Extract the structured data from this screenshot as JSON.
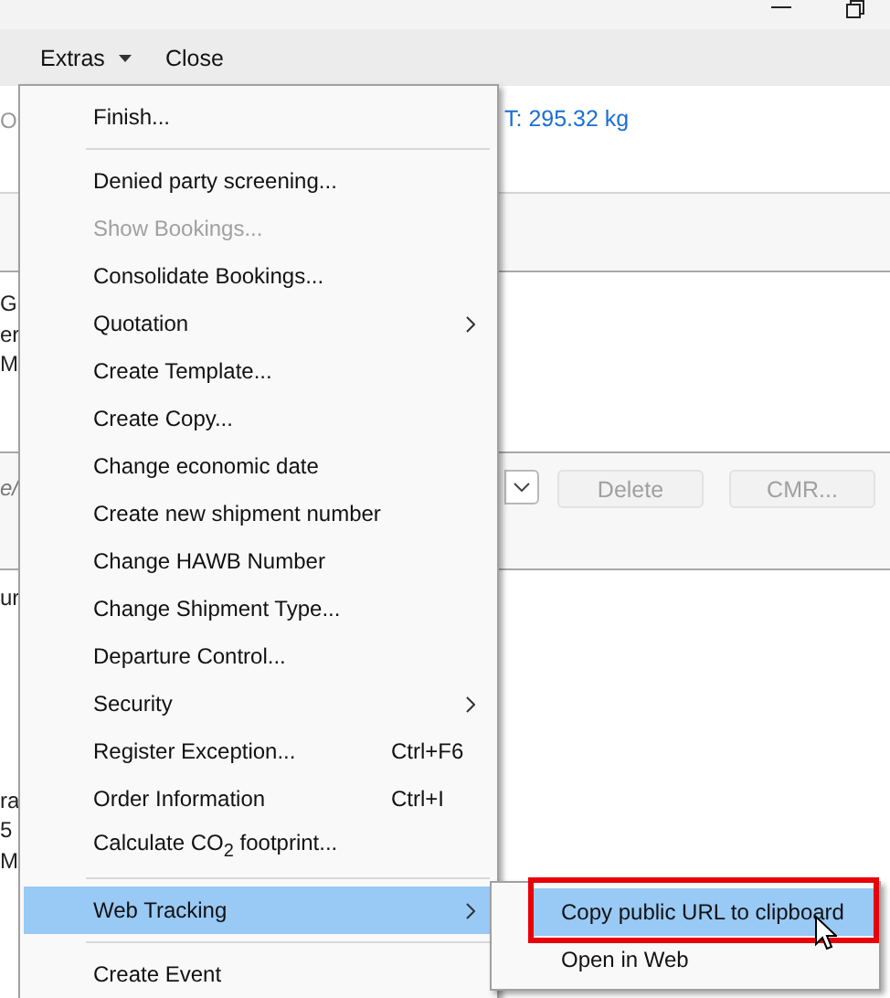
{
  "window": {
    "controls": [
      {
        "kind": "minimize"
      },
      {
        "kind": "restore"
      }
    ]
  },
  "toolbar": [
    {
      "label": "Extras",
      "dropdown": true
    },
    {
      "label": "Close",
      "dropdown": false
    }
  ],
  "header": {
    "weight_text": "T: 295.32 kg"
  },
  "background_fragments": [
    "O",
    "G",
    "er",
    "M",
    "e/",
    "ur",
    "ra",
    "5",
    "M"
  ],
  "actions": [
    {
      "label": "Delete",
      "disabled": true
    },
    {
      "label": "CMR...",
      "disabled": true
    }
  ],
  "menu": [
    {
      "kind": "item",
      "label": "Finish...",
      "disabled": false,
      "submenu": false,
      "selected": false
    },
    {
      "kind": "separator"
    },
    {
      "kind": "item",
      "label": "Denied party screening...",
      "disabled": false,
      "submenu": false,
      "selected": false
    },
    {
      "kind": "item",
      "label": "Show Bookings...",
      "disabled": true,
      "submenu": false,
      "selected": false
    },
    {
      "kind": "item",
      "label": "Consolidate Bookings...",
      "disabled": false,
      "submenu": false,
      "selected": false
    },
    {
      "kind": "item",
      "label": "Quotation",
      "disabled": false,
      "submenu": true,
      "selected": false
    },
    {
      "kind": "item",
      "label": "Create Template...",
      "disabled": false,
      "submenu": false,
      "selected": false
    },
    {
      "kind": "item",
      "label": "Create Copy...",
      "disabled": false,
      "submenu": false,
      "selected": false
    },
    {
      "kind": "item",
      "label": "Change economic date",
      "disabled": false,
      "submenu": false,
      "selected": false
    },
    {
      "kind": "item",
      "label": "Create new shipment number",
      "disabled": false,
      "submenu": false,
      "selected": false
    },
    {
      "kind": "item",
      "label": "Change HAWB Number",
      "disabled": false,
      "submenu": false,
      "selected": false
    },
    {
      "kind": "item",
      "label": "Change Shipment Type...",
      "disabled": false,
      "submenu": false,
      "selected": false
    },
    {
      "kind": "item",
      "label": "Departure Control...",
      "disabled": false,
      "submenu": false,
      "selected": false
    },
    {
      "kind": "item",
      "label": "Security",
      "disabled": false,
      "submenu": true,
      "selected": false
    },
    {
      "kind": "item",
      "label": "Register Exception...",
      "shortcut": "Ctrl+F6",
      "disabled": false,
      "submenu": false,
      "selected": false
    },
    {
      "kind": "item",
      "label": "Order Information",
      "shortcut": "Ctrl+I",
      "disabled": false,
      "submenu": false,
      "selected": false
    },
    {
      "kind": "item",
      "label": "Calculate CO$_{2}$ footprint...",
      "disabled": false,
      "submenu": false,
      "selected": false
    },
    {
      "kind": "separator"
    },
    {
      "kind": "item",
      "label": "Web Tracking",
      "disabled": false,
      "submenu": true,
      "selected": true
    },
    {
      "kind": "separator"
    },
    {
      "kind": "item",
      "label": "Create Event",
      "disabled": false,
      "submenu": false,
      "selected": false
    }
  ],
  "submenu": [
    {
      "label": "Copy public URL to clipboard",
      "selected": true,
      "highlighted": true
    },
    {
      "label": "Open in Web",
      "selected": false,
      "highlighted": false
    }
  ]
}
